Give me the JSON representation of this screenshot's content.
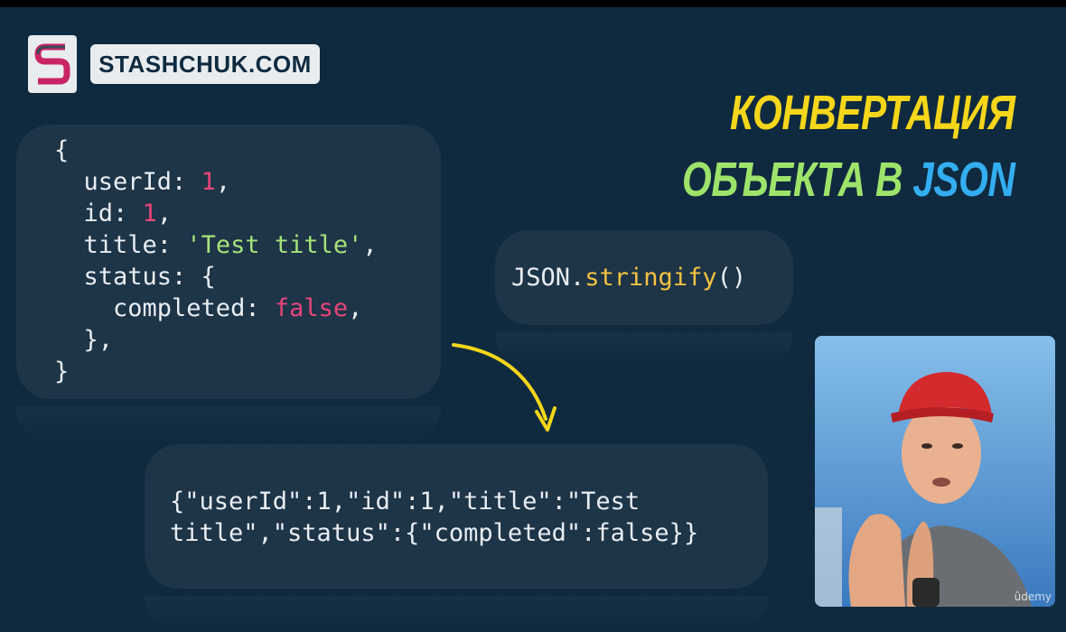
{
  "brand": {
    "name": "STASHCHUK.COM"
  },
  "title": {
    "line1": "КОНВЕРТАЦИЯ",
    "line2_a": "ОБЪЕКТА В",
    "line2_b": "JSON"
  },
  "object_code": {
    "l1": "{",
    "l2_key": "  userId: ",
    "l2_val": "1",
    "l2_end": ",",
    "l3_key": "  id: ",
    "l3_val": "1",
    "l3_end": ",",
    "l4_key": "  title: ",
    "l4_val": "'Test title'",
    "l4_end": ",",
    "l5": "  status: {",
    "l6_key": "    completed: ",
    "l6_val": "false",
    "l6_end": ",",
    "l7": "  },",
    "l8": "}"
  },
  "method": {
    "obj": "JSON.",
    "fn": "stringify",
    "parens": "()"
  },
  "result": {
    "line1": "{\"userId\":1,\"id\":1,\"title\":\"Test",
    "line2": "title\",\"status\":{\"completed\":false}}"
  },
  "watermark": "ûdemy",
  "colors": {
    "background": "#0f2a3f",
    "box": "#1e3447",
    "accent_yellow": "#f5d61a",
    "accent_green": "#9ee36a",
    "accent_blue": "#33aef0",
    "number": "#e6457a"
  }
}
